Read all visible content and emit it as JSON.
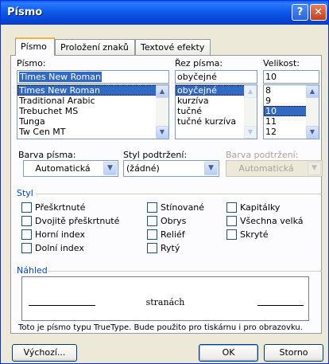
{
  "window": {
    "title": "Písmo",
    "help_glyph": "?",
    "close_glyph": "✕"
  },
  "tabs": [
    {
      "label": "Písmo",
      "active": true
    },
    {
      "label": "Proložení znaků",
      "active": false
    },
    {
      "label": "Textové efekty",
      "active": false
    }
  ],
  "font": {
    "label": "Písmo:",
    "value": "Times New Roman",
    "items": [
      "Times New Roman",
      "Traditional Arabic",
      "Trebuchet MS",
      "Tunga",
      "Tw Cen MT"
    ],
    "selected": "Times New Roman"
  },
  "style": {
    "label": "Řez písma:",
    "value": "obyčejné",
    "items": [
      "obyčejné",
      "kurzíva",
      "tučné",
      "tučné kurzíva"
    ],
    "selected": "obyčejné"
  },
  "size": {
    "label": "Velikost:",
    "value": "10",
    "items": [
      "8",
      "9",
      "10",
      "11",
      "12"
    ],
    "selected": "10"
  },
  "font_color": {
    "label": "Barva písma:",
    "value": "Automatická"
  },
  "underline_style": {
    "label": "Styl podtržení:",
    "value": "(žádné)"
  },
  "underline_color": {
    "label": "Barva podtržení:",
    "value": "Automatická",
    "enabled": false
  },
  "effects": {
    "group_label": "Styl",
    "col1": [
      "Přeškrtnuté",
      "Dvojitě přeškrtnuté",
      "Horní index",
      "Dolní index"
    ],
    "col2": [
      "Stínované",
      "Obrys",
      "Reliéf",
      "Rytý"
    ],
    "col3": [
      "Kapitálky",
      "Všechna velká",
      "Skryté"
    ]
  },
  "preview": {
    "group_label": "Náhled",
    "sample_text": "stranách",
    "note": "Toto je písmo typu TrueType. Bude použito pro tiskárnu i pro obrazovku."
  },
  "buttons": {
    "default": "Výchozí...",
    "ok": "OK",
    "cancel": "Storno"
  },
  "colors": {
    "selection": "#316ac5",
    "group_label": "#0046d5",
    "titlebar": "#0546d7"
  }
}
